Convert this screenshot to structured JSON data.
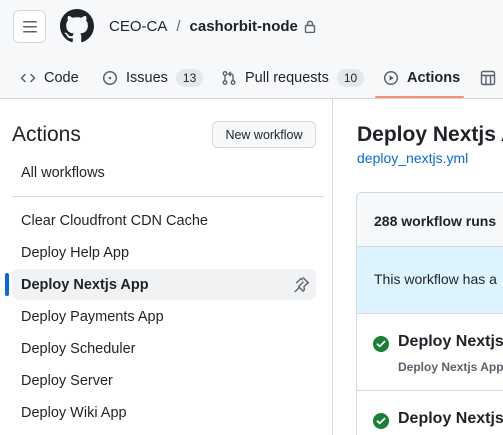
{
  "header": {
    "owner": "CEO-CA",
    "separator": "/",
    "repo": "cashorbit-node",
    "icons": {
      "menu": "hamburger-icon",
      "logo": "github-logo",
      "lock": "lock-icon"
    }
  },
  "tabs": [
    {
      "label": "Code",
      "icon": "code-icon"
    },
    {
      "label": "Issues",
      "icon": "issue-icon",
      "count": "13"
    },
    {
      "label": "Pull requests",
      "icon": "pull-request-icon",
      "count": "10"
    },
    {
      "label": "Actions",
      "icon": "play-icon",
      "active": true
    },
    {
      "label": "",
      "icon": "projects-icon"
    }
  ],
  "sidebar": {
    "title": "Actions",
    "new_workflow_label": "New workflow",
    "all_workflows_label": "All workflows",
    "workflows": [
      {
        "label": "Clear Cloudfront CDN Cache"
      },
      {
        "label": "Deploy Help App"
      },
      {
        "label": "Deploy Nextjs App",
        "selected": true
      },
      {
        "label": "Deploy Payments App"
      },
      {
        "label": "Deploy Scheduler"
      },
      {
        "label": "Deploy Server"
      },
      {
        "label": "Deploy Wiki App"
      }
    ]
  },
  "main": {
    "title": "Deploy Nextjs App",
    "file": "deploy_nextjs.yml",
    "runs_count": "288 workflow runs",
    "notice": "This workflow has a",
    "runs": [
      {
        "title": "Deploy Nextjs",
        "subtitle": "Deploy Nextjs App",
        "status": "success"
      },
      {
        "title": "Deploy Nextjs",
        "subtitle": "",
        "status": "success"
      }
    ]
  },
  "colors": {
    "accent": "#0969da",
    "tab_underline": "#fd8c73",
    "success": "#1a7f37",
    "notice_bg": "#ddf4ff"
  }
}
